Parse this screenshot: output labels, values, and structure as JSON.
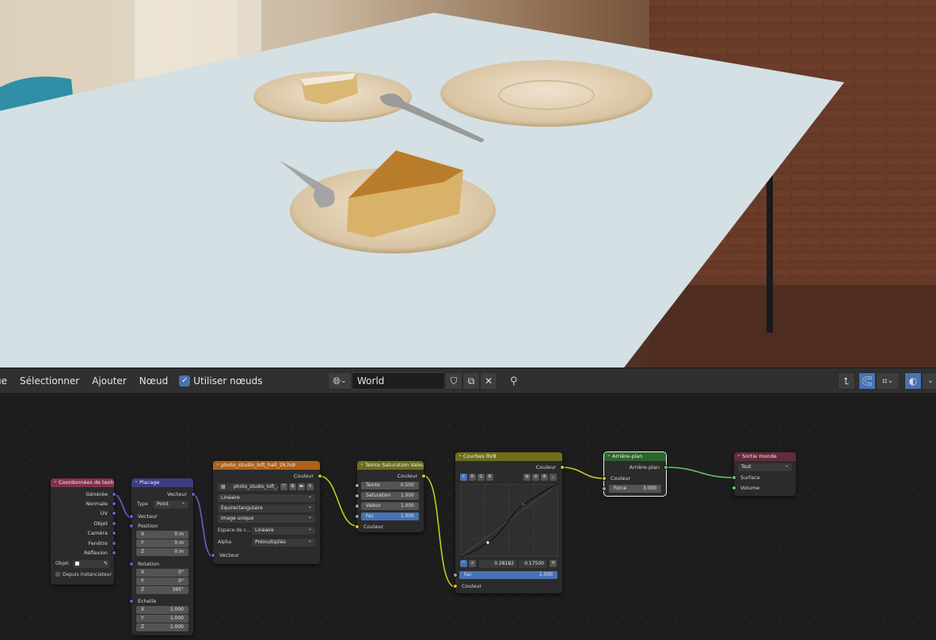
{
  "header": {
    "menu": [
      "ue",
      "Sélectionner",
      "Ajouter",
      "Nœud"
    ],
    "use_nodes_label": "Utiliser nœuds",
    "world_name": "World",
    "checkmark": "✓"
  },
  "icons": {
    "world": "globe-icon",
    "shield": "shield-icon",
    "duplicate": "duplicate-icon",
    "close": "close-icon",
    "pin": "pin-icon",
    "parent": "parent-node-icon",
    "snap": "snap-icon",
    "overlay": "overlay-icon"
  },
  "colors": {
    "vector_header": "#3c3c83",
    "input_header": "#83314a",
    "texture_header": "#b0611a",
    "color_header": "#6e6e1c",
    "shader_header": "#2b652b",
    "output_header": "#632c3a",
    "accent": "#4772b3"
  },
  "nodes": {
    "texcoord": {
      "title": "Coordonnées de texture",
      "outputs": [
        "Générée",
        "Normale",
        "UV",
        "Objet",
        "Caméra",
        "Fenêtre",
        "Réflexion"
      ],
      "object_label": "Objet:",
      "from_instancer": "Depuis instanciateur"
    },
    "mapping": {
      "title": "Placage",
      "output": "Vecteur",
      "type_label": "Type",
      "type_value": "Point",
      "input_vector": "Vecteur",
      "position_label": "Position",
      "position": {
        "x": "0 m",
        "y": "0 m",
        "z": "0 m"
      },
      "rotation_label": "Rotation",
      "rotation": {
        "x": "0°",
        "y": "0°",
        "z": "365°"
      },
      "scale_label": "Échelle",
      "scale": {
        "x": "1.000",
        "y": "1.000",
        "z": "1.000"
      },
      "axis": {
        "x": "X",
        "y": "Y",
        "z": "Z"
      }
    },
    "envtex": {
      "title": "photo_studio_loft_hall_2k.hdr",
      "output": "Couleur",
      "image_name": "photo_studio_loft_...",
      "interpolation": "Linéaire",
      "projection": "Équirectangulaire",
      "extension": "Image unique",
      "colorspace_label": "Espace de c...",
      "colorspace_value": "Linéaire",
      "alpha_label": "Alpha",
      "alpha_value": "Prémultipliés",
      "input_vector": "Vecteur"
    },
    "hsv": {
      "title": "Teinte Saturation Valeur",
      "output": "Couleur",
      "hue_label": "Teinte",
      "hue": "0.500",
      "saturation_label": "Saturation",
      "saturation": "1.000",
      "value_label": "Valeur",
      "value": "1.000",
      "fac_label": "Fac",
      "fac": "1.000",
      "input_color": "Couleur"
    },
    "curves": {
      "title": "Courbes RVB",
      "output": "Couleur",
      "channels": [
        "C",
        "R",
        "G",
        "B"
      ],
      "point_x": "0.28182",
      "point_y": "0.17500",
      "fac_label": "Fac",
      "fac": "1.000",
      "input_color": "Couleur"
    },
    "background": {
      "title": "Arrière-plan",
      "output": "Arrière-plan",
      "input_color": "Couleur",
      "strength_label": "Force",
      "strength": "3.000"
    },
    "world_output": {
      "title": "Sortie monde",
      "target": "Tout",
      "surface": "Surface",
      "volume": "Volume"
    }
  }
}
